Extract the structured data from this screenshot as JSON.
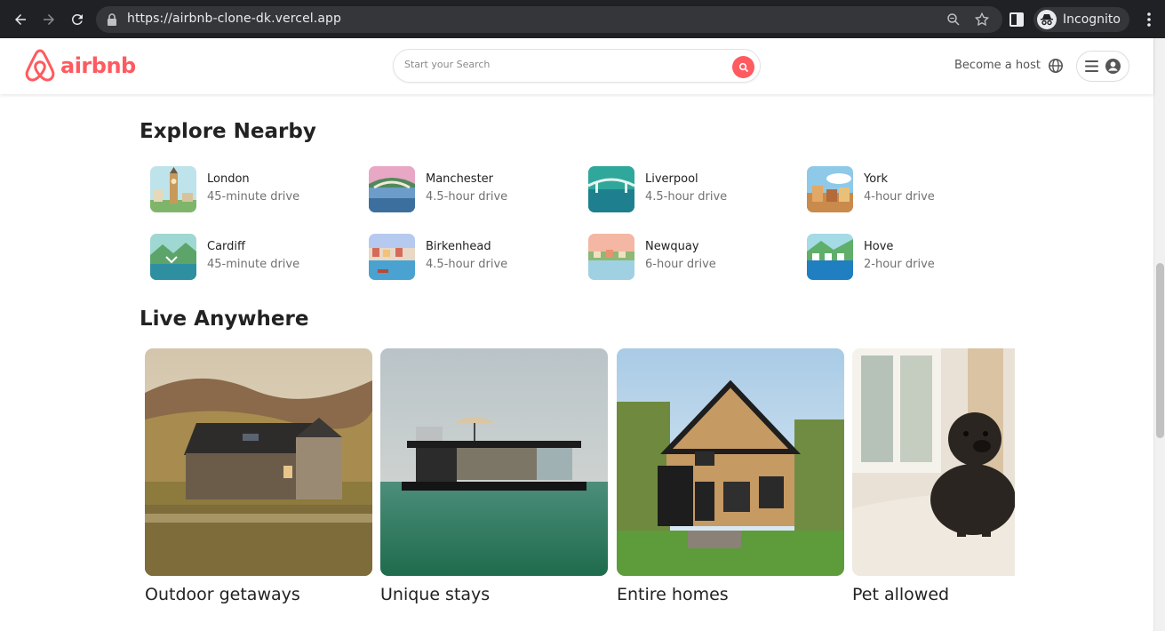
{
  "browser": {
    "url_host": "https://airbnb-clone-dk.vercel.app",
    "incognito_label": "Incognito"
  },
  "header": {
    "logo_text": "airbnb",
    "search_placeholder": "Start your Search",
    "host_link": "Become a host",
    "brand_color": "#ff5a5f"
  },
  "explore": {
    "title": "Explore Nearby",
    "items": [
      {
        "name": "London",
        "distance": "45-minute drive"
      },
      {
        "name": "Manchester",
        "distance": "4.5-hour drive"
      },
      {
        "name": "Liverpool",
        "distance": "4.5-hour drive"
      },
      {
        "name": "York",
        "distance": "4-hour drive"
      },
      {
        "name": "Cardiff",
        "distance": "45-minute drive"
      },
      {
        "name": "Birkenhead",
        "distance": "4.5-hour drive"
      },
      {
        "name": "Newquay",
        "distance": "6-hour drive"
      },
      {
        "name": "Hove",
        "distance": "2-hour drive"
      }
    ]
  },
  "live": {
    "title": "Live Anywhere",
    "cards": [
      {
        "title": "Outdoor getaways"
      },
      {
        "title": "Unique stays"
      },
      {
        "title": "Entire homes"
      },
      {
        "title": "Pet allowed"
      }
    ]
  }
}
